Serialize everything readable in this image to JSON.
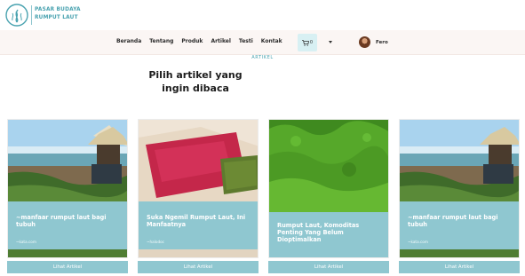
{
  "brand": {
    "line1": "PASAR BUDAYA",
    "line2": "RUMPUT LAUT"
  },
  "nav": {
    "links": [
      "Beranda",
      "Tentang",
      "Produk",
      "Artikel",
      "Testi",
      "Kontak"
    ],
    "cart_count": "0",
    "user_name": "Fero"
  },
  "section": {
    "label": "ARTIKEL",
    "title": "Pilih artikel yang ingin dibaca"
  },
  "articles": [
    {
      "title": "~manfaar rumput laut bagi tubuh",
      "source": "~kata.com",
      "button": "Lihat Artikel"
    },
    {
      "title": "Suka Ngemil Rumput Laut, Ini Manfaatnya",
      "source": "~halodoc",
      "button": "Lihat Artikel"
    },
    {
      "title": "Rumput Laut, Komoditas Penting Yang Belum Dioptimalkan",
      "source": "",
      "button": "Lihat Artikel"
    },
    {
      "title": "~manfaar rumput laut bagi tubuh",
      "source": "~kata.com",
      "button": "Lihat Artikel"
    }
  ],
  "colors": {
    "accent": "#8fc7d0",
    "brand": "#4aa3b0",
    "nav_bg": "#fbf6f4",
    "cart_bg": "#d8f0f3"
  }
}
